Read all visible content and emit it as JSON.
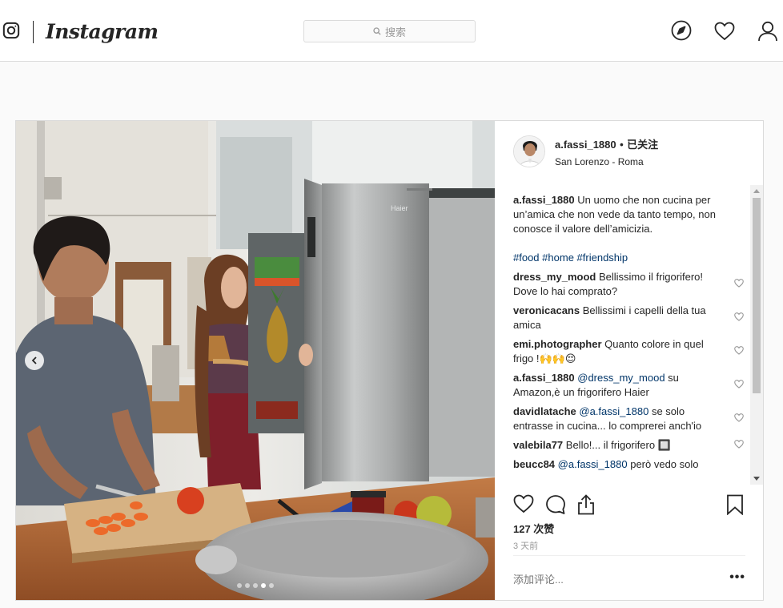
{
  "header": {
    "brand": "Instagram",
    "search_placeholder": "搜索"
  },
  "post": {
    "author": {
      "username": "a.fassi_1880",
      "separator": "•",
      "follow_label": "已关注",
      "location": "San Lorenzo - Roma"
    },
    "caption": {
      "username": "a.fassi_1880",
      "text": "Un uomo che non cucina per un’amica che non vede da tanto tempo, non conosce il valore dell’amicizia.",
      "hashtags": [
        "#food",
        "#home",
        "#friendship"
      ]
    },
    "comments": [
      {
        "user": "dress_my_mood",
        "mention": "",
        "text": "Bellissimo il frigorifero! Dove lo hai comprato?"
      },
      {
        "user": "veronicacans",
        "mention": "",
        "text": "Bellissimi i capelli della tua amica"
      },
      {
        "user": "emi.photographer",
        "mention": "",
        "text": "Quanto colore in quel frigo !🙌🙌😌"
      },
      {
        "user": "a.fassi_1880",
        "mention": "@dress_my_mood",
        "text": "su Amazon,è un frigorifero Haier"
      },
      {
        "user": "davidlatache",
        "mention": "@a.fassi_1880",
        "text": "se solo entrasse in cucina... lo comprerei anch'io"
      },
      {
        "user": "valebila77",
        "mention": "",
        "text": "Bello!... il frigorifero 🔲"
      },
      {
        "user": "beucc84",
        "mention": "@a.fassi_1880",
        "text": "però vedo solo"
      }
    ],
    "likes": "127 次赞",
    "time_ago": "3 天前",
    "add_comment_placeholder": "添加评论...",
    "more_label": "•••",
    "carousel": {
      "count": 5,
      "active": 4
    },
    "photo_brand": "Haier"
  },
  "colors": {
    "link": "#003569",
    "border": "#dbdbdb",
    "background": "#fafafa"
  }
}
